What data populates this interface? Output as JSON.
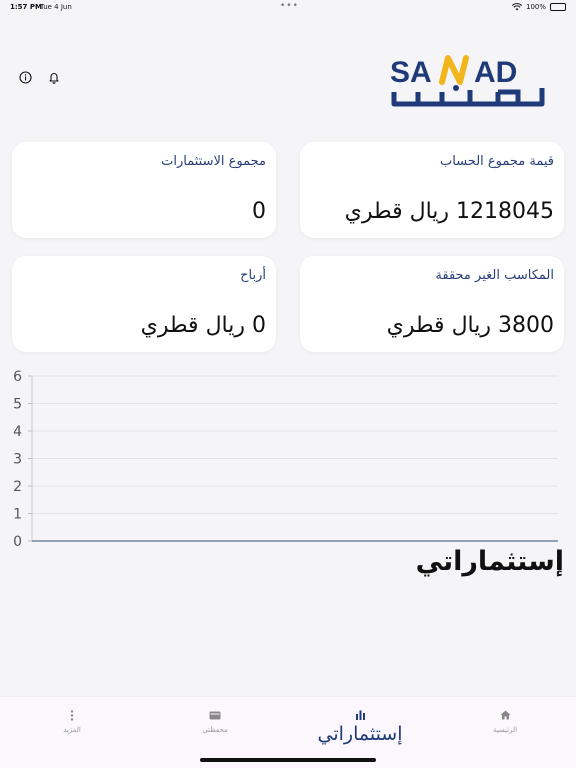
{
  "status_bar": {
    "time": "1:57 PM",
    "date": "Tue 4 Jun",
    "battery": "100%"
  },
  "logo": {
    "text": "SANAD",
    "text_ar": "سند",
    "colors": {
      "primary": "#1e3a78",
      "accent": "#f2b51c"
    }
  },
  "header": {
    "icons": [
      "info-icon",
      "bell-icon"
    ]
  },
  "cards": {
    "account_total": {
      "label": "قيمة مجموع الحساب",
      "value": "1218045 ريال قطري"
    },
    "investments_total": {
      "label": "مجموع الاستثمارات",
      "value": "0"
    },
    "unrealized_gains": {
      "label": "المكاسب الغير محققة",
      "value": "3800 ريال قطري"
    },
    "profits": {
      "label": "أرباح",
      "value": "0 ريال قطري"
    }
  },
  "chart_data": {
    "type": "line",
    "title": "",
    "xlabel": "",
    "ylabel": "",
    "ylim": [
      0,
      6
    ],
    "yticks": [
      "0",
      "1",
      "2",
      "3",
      "4",
      "5",
      "6"
    ],
    "series": [
      {
        "values": [
          0,
          0
        ]
      }
    ],
    "grid": true
  },
  "section": {
    "title": "إستثماراتي"
  },
  "tab_bar": {
    "home": {
      "label": "الرئيسية",
      "icon": "home-icon"
    },
    "investments": {
      "label": "إستثماراتي",
      "icon": "bar-chart-icon"
    },
    "wallet": {
      "label": "محفظتي",
      "icon": "wallet-icon"
    },
    "more": {
      "label": "المزيد",
      "icon": "more-vertical-icon"
    },
    "colors": {
      "active": "#1e3a78",
      "inactive": "#999999"
    }
  }
}
